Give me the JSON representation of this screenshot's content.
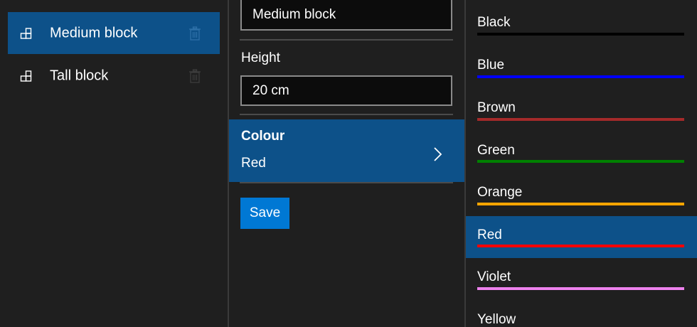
{
  "blocks": {
    "items": [
      {
        "label": "Medium block",
        "selected": true
      },
      {
        "label": "Tall block",
        "selected": false
      }
    ]
  },
  "editor": {
    "name_value": "Medium block",
    "height_label": "Height",
    "height_value": "20 cm",
    "colour_label": "Colour",
    "colour_value": "Red",
    "save_label": "Save"
  },
  "colours": {
    "items": [
      {
        "name": "Black",
        "swatch": "#000000",
        "selected": false
      },
      {
        "name": "Blue",
        "swatch": "#0000ff",
        "selected": false
      },
      {
        "name": "Brown",
        "swatch": "#a52a2a",
        "selected": false
      },
      {
        "name": "Green",
        "swatch": "#008000",
        "selected": false
      },
      {
        "name": "Orange",
        "swatch": "#ffa500",
        "selected": false
      },
      {
        "name": "Red",
        "swatch": "#ff0000",
        "selected": true
      },
      {
        "name": "Violet",
        "swatch": "#ee82ee",
        "selected": false
      },
      {
        "name": "Yellow",
        "swatch": "#ffff00",
        "selected": false
      }
    ]
  },
  "theme": {
    "accent": "#0078d4",
    "selection": "#0d5189",
    "background": "#1f1f1f"
  }
}
